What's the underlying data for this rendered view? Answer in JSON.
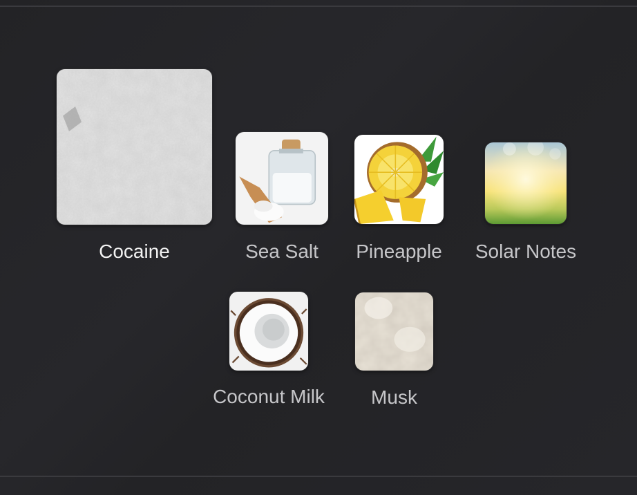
{
  "notes": {
    "primary": [
      {
        "name": "Cocaine",
        "icon": "powder-image"
      }
    ],
    "secondary_row1": [
      {
        "name": "Sea Salt",
        "icon": "sea-salt-jar-image"
      },
      {
        "name": "Pineapple",
        "icon": "pineapple-image"
      },
      {
        "name": "Solar Notes",
        "icon": "sunlight-bokeh-image"
      }
    ],
    "secondary_row2": [
      {
        "name": "Coconut Milk",
        "icon": "coconut-image"
      },
      {
        "name": "Musk",
        "icon": "musk-texture-image"
      }
    ]
  },
  "colors": {
    "background": "#242427",
    "rule": "#3a3a3e",
    "primary_text": "#f2f2f2",
    "secondary_text": "#c6c6c9"
  }
}
